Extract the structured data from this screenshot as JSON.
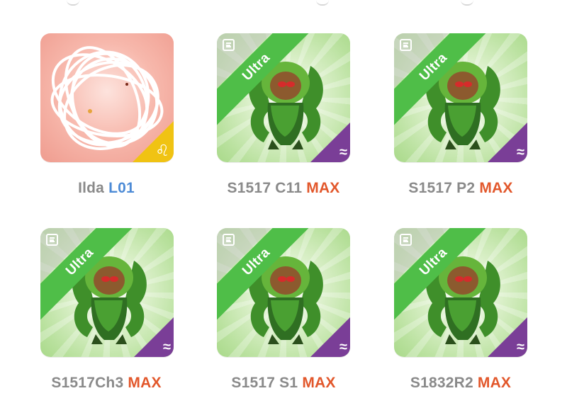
{
  "colors": {
    "max_accent": "#e2572b",
    "level_accent": "#4d8bd6",
    "caption_gray": "#8a8a8a",
    "ultra_ribbon": "#4fbe48",
    "element_corner": "#7a3e97",
    "zodiac_corner": "#f0c313",
    "card_green": "#b9e19e",
    "card_pink": "#f7b8ac"
  },
  "icons": {
    "calendar": "calendar-icon",
    "element": "water-element-icon",
    "zodiac": "leo-zodiac-icon"
  },
  "symbols": {
    "element_glyph": "≈",
    "zodiac_glyph": "♌"
  },
  "grid": {
    "cards": [
      {
        "style": "pink",
        "ribbon": "",
        "caption": {
          "name": "Ilda",
          "suffix": "L01",
          "suffix_kind": "level"
        }
      },
      {
        "style": "green",
        "ribbon": "Ultra",
        "caption": {
          "name": "S1517 C11",
          "suffix": "MAX",
          "suffix_kind": "max"
        }
      },
      {
        "style": "green",
        "ribbon": "Ultra",
        "caption": {
          "name": "S1517 P2",
          "suffix": "MAX",
          "suffix_kind": "max"
        }
      },
      {
        "style": "green",
        "ribbon": "Ultra",
        "caption": {
          "name": "S1517Ch3",
          "suffix": "MAX",
          "suffix_kind": "max"
        }
      },
      {
        "style": "green",
        "ribbon": "Ultra",
        "caption": {
          "name": "S1517 S1",
          "suffix": "MAX",
          "suffix_kind": "max"
        }
      },
      {
        "style": "green",
        "ribbon": "Ultra",
        "caption": {
          "name": "S1832R2",
          "suffix": "MAX",
          "suffix_kind": "max"
        }
      }
    ]
  }
}
